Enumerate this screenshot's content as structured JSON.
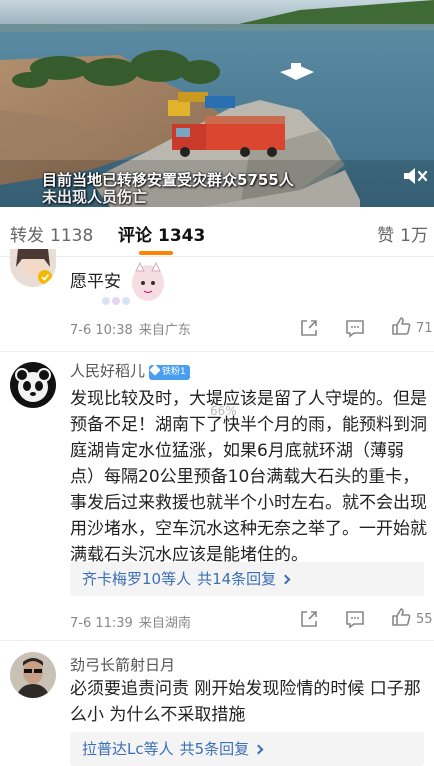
{
  "video": {
    "caption_line1": "目前当地已转移安置受灾群众5755人",
    "caption_line2": "未出现人员伤亡",
    "mute_icon": "speaker-muted-icon"
  },
  "tabs": {
    "repost_label": "转发",
    "repost_count": "1138",
    "comment_label": "评论",
    "comment_count": "1343",
    "like_label": "赞",
    "like_count": "1万"
  },
  "comments": [
    {
      "text": "愿平安",
      "time": "7-6 10:38",
      "location": "来自广东",
      "likes": "71"
    },
    {
      "author": "人民好稻儿",
      "badge": "铁粉1",
      "text": "发现比较及时，大堤应该是留了人守堤的。但是预备不足！湖南下了快半个月的雨，能预料到洞庭湖肯定水位猛涨，如果6月底就环湖（薄弱点）每隔20公里预备10台满载大石头的重卡，事发后过来救援也就半个小时左右。就不会出现用沙堵水，空车沉水这种无奈之举了。一开始就满载石头沉水应该是能堵住的。",
      "replies_users": "齐卡梅罗10等人",
      "replies_count": "共14条回复",
      "time": "7-6 11:39",
      "location": "来自湖南",
      "likes": "55"
    },
    {
      "author": "劲弓长箭射日月",
      "text": "必须要追责问责 刚开始发现险情的时候 口子那么小 为什么不采取措施",
      "replies_users": "拉普达Lc等人",
      "replies_count": "共5条回复"
    }
  ],
  "overlay": {
    "watermark": "66%"
  },
  "colors": {
    "accent": "#ff8200",
    "link": "#3b6fb6",
    "badge": "#4a9ef0"
  }
}
